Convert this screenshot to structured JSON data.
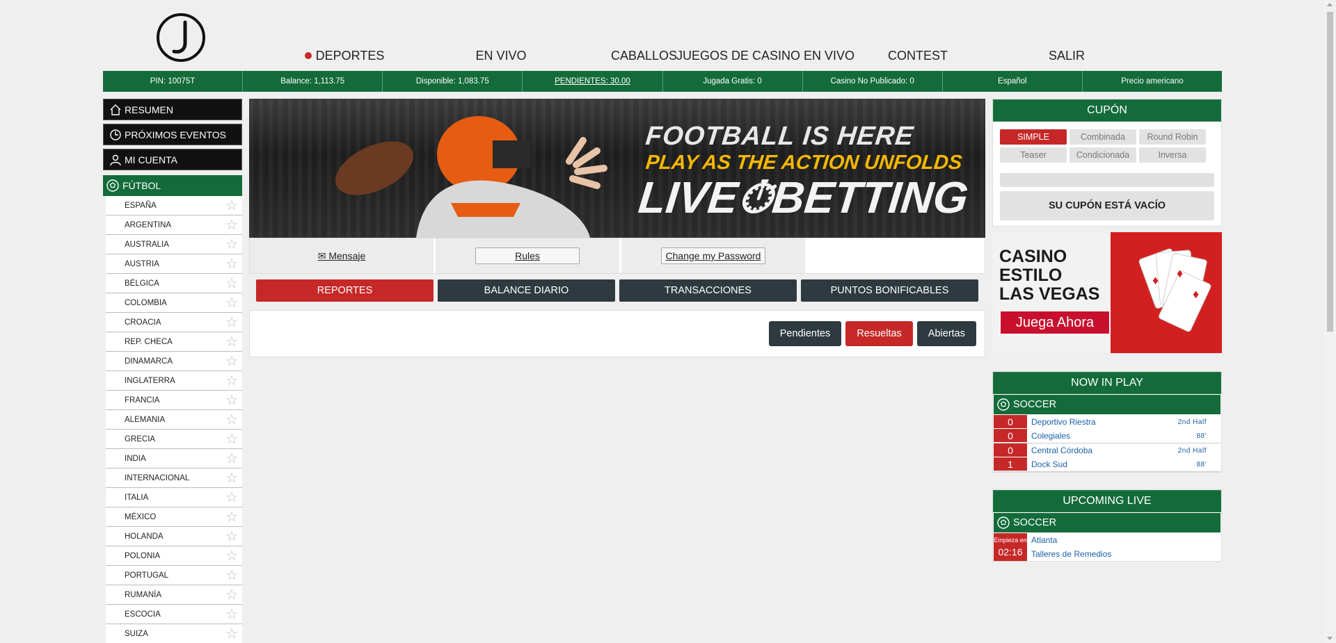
{
  "nav": {
    "items": [
      "DEPORTES",
      "EN VIVO",
      "CABALLOS",
      "JUEGOS DE CASINO EN VIVO",
      "CONTEST",
      "SALIR"
    ],
    "active_index": 0
  },
  "infobar": {
    "pin": "PIN: 10075T",
    "balance": "Balance: 1,113.75",
    "disponible": "Disponible: 1,083.75",
    "pendientes": "PENDIENTES: 30.00",
    "jugada_gratis": "Jugada Gratis: 0",
    "casino_no_publicado": "Casino No Publicado: 0",
    "language": "Español",
    "odds_format": "Precio americano"
  },
  "sidebar": {
    "resumen": "RESUMEN",
    "proximos": "PRÓXIMOS EVENTOS",
    "cuenta": "MI CUENTA",
    "sport": "FÚTBOL",
    "leagues": [
      "ESPAÑA",
      "ARGENTINA",
      "AUSTRALIA",
      "AUSTRIA",
      "BÉLGICA",
      "COLOMBIA",
      "CROACIA",
      "REP. CHECA",
      "DINAMARCA",
      "INGLATERRA",
      "FRANCIA",
      "ALEMANIA",
      "GRECIA",
      "INDIA",
      "INTERNACIONAL",
      "ITALIA",
      "MÉXICO",
      "HOLANDA",
      "POLONIA",
      "PORTUGAL",
      "RUMANÍA",
      "ESCOCIA",
      "SUIZA"
    ]
  },
  "banner": {
    "line1": "FOOTBALL IS HERE",
    "line2": "PLAY AS THE ACTION UNFOLDS",
    "line3": "LIVE⏱BETTING"
  },
  "links": {
    "mensaje": "Mensaje",
    "rules": "Rules",
    "change_password": "Change my Password"
  },
  "tabs": [
    "REPORTES",
    "BALANCE DIARIO",
    "TRANSACCIONES",
    "PUNTOS BONIFICABLES"
  ],
  "subtabs": [
    "Pendientes",
    "Resueltas",
    "Abiertas"
  ],
  "coupon": {
    "title": "CUPÓN",
    "options": [
      "SIMPLE",
      "Combinada",
      "Round Robin",
      "Teaser",
      "Condicionada",
      "Inversa"
    ],
    "empty": "SU CUPÓN ESTÁ VACÍO"
  },
  "casino_promo": {
    "title": "CASINO\nESTILO\nLAS VEGAS",
    "button": "Juega Ahora"
  },
  "now_in_play": {
    "title": "NOW IN PLAY",
    "sport": "SOCCER",
    "matches": [
      {
        "home": "Deportivo Riestra",
        "away": "Colegiales",
        "home_score": "0",
        "away_score": "0",
        "period": "2nd Half",
        "minute": "88'"
      },
      {
        "home": "Central Córdoba",
        "away": "Dock Sud",
        "home_score": "0",
        "away_score": "1",
        "period": "2nd Half",
        "minute": "88'"
      }
    ]
  },
  "upcoming_live": {
    "title": "UPCOMING LIVE",
    "sport": "SOCCER",
    "starts_label": "Empieza en",
    "countdown": "02:16",
    "home": "Atlanta",
    "away": "Talleres de Remedios"
  },
  "colors": {
    "green": "#146b3a",
    "red": "#c62828",
    "dark": "#2e3a40"
  }
}
